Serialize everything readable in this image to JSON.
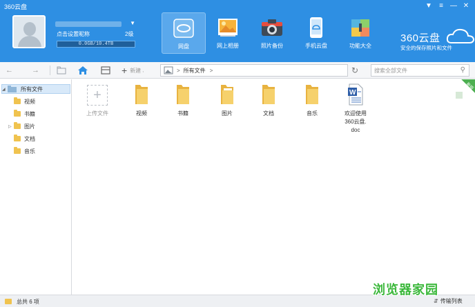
{
  "window": {
    "title": "360云盘"
  },
  "user": {
    "nickname_prompt": "点击设置昵称",
    "level": "2级",
    "quota": "0.0GB/10.4TB"
  },
  "nav": [
    {
      "label": "网盘",
      "icon": "cloud-disk-icon",
      "active": true
    },
    {
      "label": "网上相册",
      "icon": "photo-album-icon",
      "active": false
    },
    {
      "label": "照片备份",
      "icon": "camera-icon",
      "active": false
    },
    {
      "label": "手机云盘",
      "icon": "mobile-cloud-icon",
      "active": false
    },
    {
      "label": "功能大全",
      "icon": "toolbox-icon",
      "active": false
    }
  ],
  "brand": {
    "logo": "360云盘",
    "tagline": "安全的保存照片和文件"
  },
  "toolbar": {
    "new_label": "新建",
    "path_root": "所有文件",
    "search_placeholder": "搜索全部文件"
  },
  "sidebar": {
    "root": "所有文件",
    "items": [
      {
        "label": "视频"
      },
      {
        "label": "书籍"
      },
      {
        "label": "图片"
      },
      {
        "label": "文档"
      },
      {
        "label": "音乐"
      }
    ]
  },
  "files": {
    "upload_label": "上传文件",
    "folders": [
      {
        "label": "视频"
      },
      {
        "label": "书籍"
      },
      {
        "label": "图片"
      },
      {
        "label": "文档"
      },
      {
        "label": "音乐"
      }
    ],
    "doc": {
      "label": "欢迎使用\n360云盘.\ndoc"
    },
    "ribbon": "新版"
  },
  "status": {
    "total": "总共 6 项",
    "transfer": "传输列表"
  },
  "watermark": "浏览器家园",
  "colors": {
    "header": "#2e8fe3",
    "folder": "#f0c34f",
    "ribbon": "#4caf50"
  }
}
